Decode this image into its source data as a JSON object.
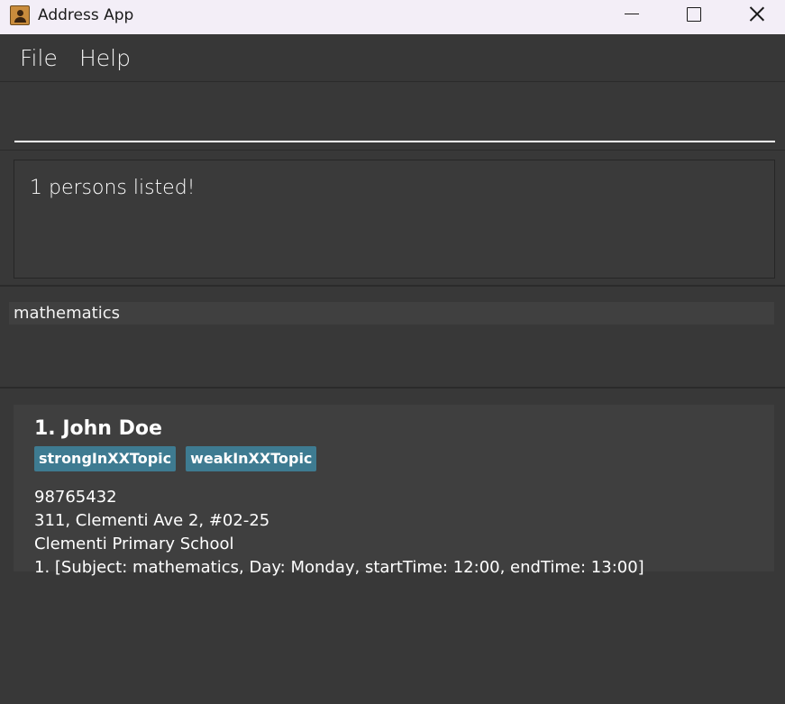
{
  "window": {
    "title": "Address App",
    "icon": "contact-book-icon"
  },
  "menu": {
    "file_label": "File",
    "help_label": "Help"
  },
  "command": {
    "value": "",
    "placeholder": ""
  },
  "result": {
    "message": "1 persons listed!"
  },
  "subject_filter": {
    "text": "mathematics"
  },
  "persons": [
    {
      "name": "1. John Doe",
      "tags": [
        "strongInXXTopic",
        "weakInXXTopic"
      ],
      "phone": "98765432",
      "address": "311, Clementi Ave 2, #02-25",
      "school": "Clementi Primary School",
      "lesson": "1. [Subject: mathematics, Day: Monday, startTime: 12:00, endTime: 13:00]"
    }
  ],
  "colors": {
    "background": "#383838",
    "tag": "#3e7b91",
    "titlebar": "#f3eef7"
  }
}
